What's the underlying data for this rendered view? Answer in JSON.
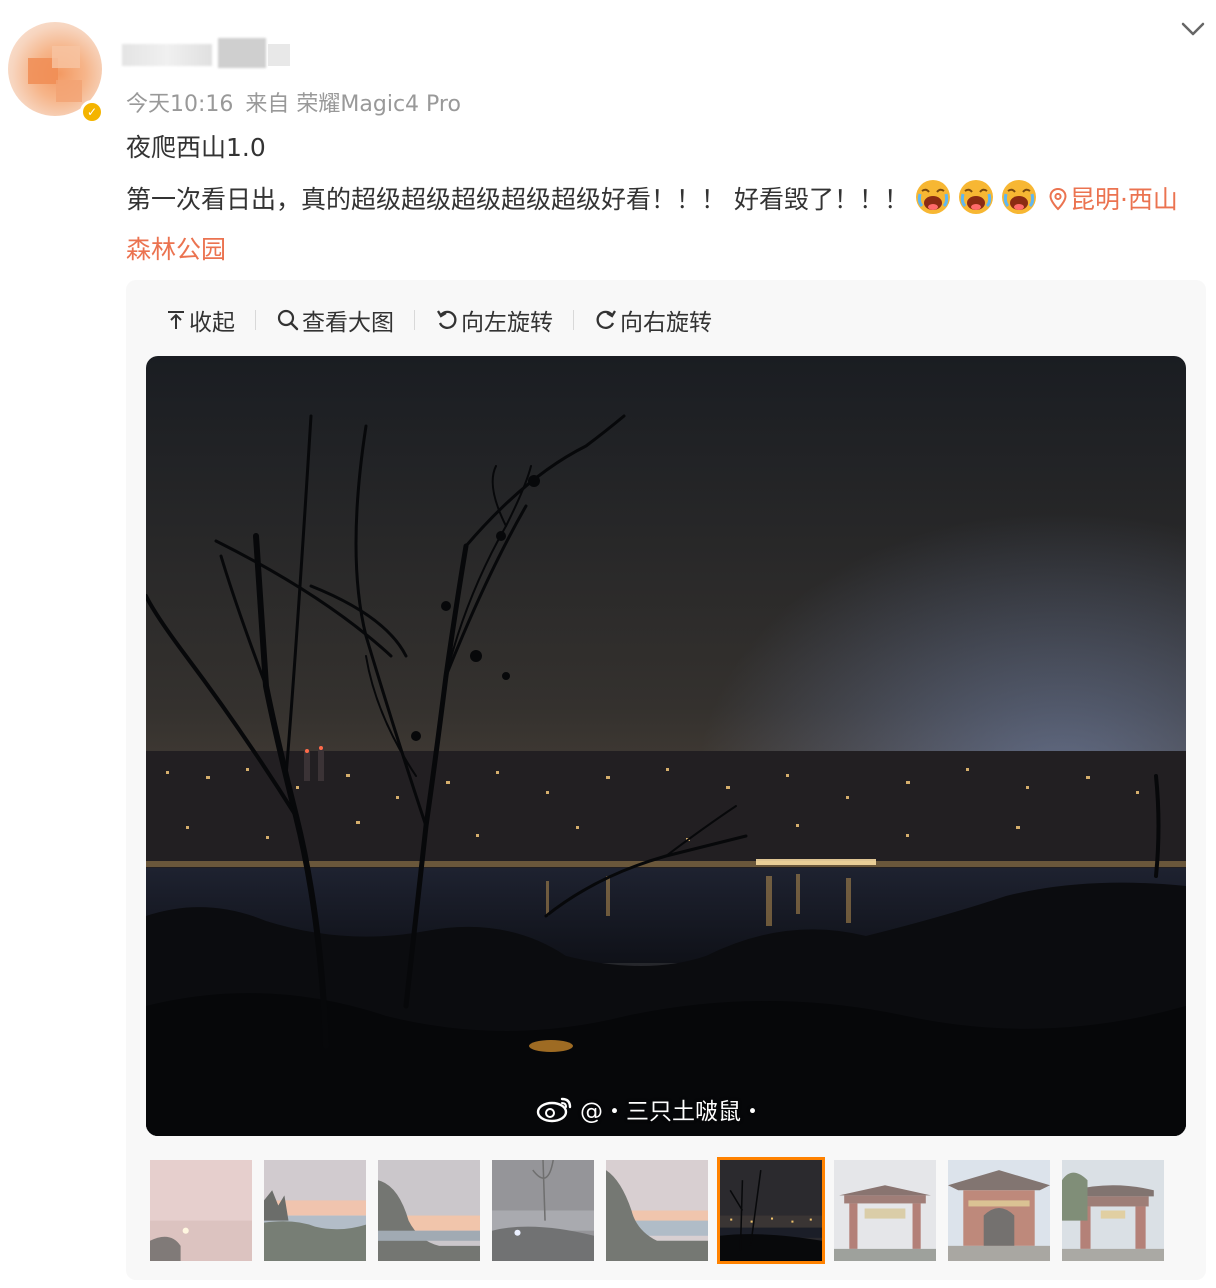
{
  "post": {
    "meta_time": "今天10:16",
    "meta_source": "来自 荣耀Magic4 Pro",
    "title": "夜爬西山1.0",
    "body_text": "第一次看日出，真的超级超级超级超级超级好看！！！ 好看毁了！！！",
    "emojis": [
      "crying-laugh-emoji",
      "crying-laugh-emoji",
      "crying-laugh-emoji"
    ],
    "location": "昆明·西山森林公园"
  },
  "toolbar": {
    "collapse": "收起",
    "view_large": "查看大图",
    "rotate_left": "向左旋转",
    "rotate_right": "向右旋转"
  },
  "photo": {
    "watermark": "@・三只土啵鼠・"
  },
  "thumbnails": [
    {
      "kind": "dawn-pink-sky"
    },
    {
      "kind": "dawn-lake"
    },
    {
      "kind": "dawn-tree"
    },
    {
      "kind": "misty-night"
    },
    {
      "kind": "dawn-lake-tree"
    },
    {
      "kind": "night-city",
      "selected": true
    },
    {
      "kind": "gate"
    },
    {
      "kind": "pavilion"
    },
    {
      "kind": "gate-archway"
    }
  ],
  "colors": {
    "accent_link": "#eb7350",
    "selected_border": "#ff8200",
    "meta_gray": "#999999"
  }
}
